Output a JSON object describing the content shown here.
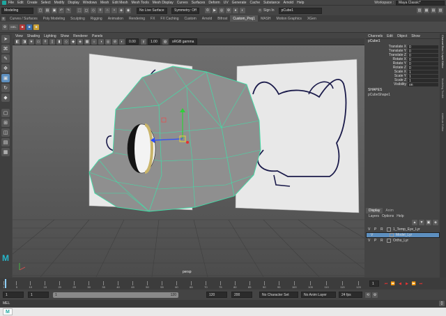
{
  "menubar": {
    "items": [
      "File",
      "Edit",
      "Create",
      "Select",
      "Modify",
      "Display",
      "Windows",
      "Mesh",
      "Edit Mesh",
      "Mesh Tools",
      "Mesh Display",
      "Curves",
      "Surfaces",
      "Deform",
      "UV",
      "Generate",
      "Cache",
      "Substance",
      "Arnold",
      "Help"
    ],
    "workspace_label": "Workspace :",
    "workspace_value": "Maya Classic*"
  },
  "statusline": {
    "mode": "Modeling",
    "live_surface": "No Live Surface",
    "symmetry": "Symmetry: Off",
    "sign_in": "Sign In",
    "search_value": "pCube1"
  },
  "shelf": {
    "tabs": [
      "Curves / Surfaces",
      "Poly Modeling",
      "Sculpting",
      "Rigging",
      "Animation",
      "Rendering",
      "FX",
      "FX Caching",
      "Custom",
      "Arnold",
      "Bifrost",
      "Custom_Proj1",
      "MASH",
      "Motion Graphics",
      "XGen"
    ],
    "active_index": 11
  },
  "viewport": {
    "menu": [
      "View",
      "Shading",
      "Lighting",
      "Show",
      "Renderer",
      "Panels"
    ],
    "gamma": "sRGB gamma",
    "exposure": "0.00",
    "gamma_value": "1.00",
    "camera_label": "persp"
  },
  "channelbox": {
    "tabs": [
      "Channels",
      "Edit",
      "Object",
      "Show"
    ],
    "object_name": "pCube1",
    "attributes": [
      {
        "name": "Translate X",
        "value": "0"
      },
      {
        "name": "Translate Y",
        "value": "0"
      },
      {
        "name": "Translate Z",
        "value": "0"
      },
      {
        "name": "Rotate X",
        "value": "0"
      },
      {
        "name": "Rotate Y",
        "value": "0"
      },
      {
        "name": "Rotate Z",
        "value": "0"
      },
      {
        "name": "Scale X",
        "value": "1"
      },
      {
        "name": "Scale Y",
        "value": "1"
      },
      {
        "name": "Scale Z",
        "value": "1"
      },
      {
        "name": "Visibility",
        "value": "on"
      }
    ],
    "shapes_heading": "SHAPES",
    "shape_name": "pCubeShape1"
  },
  "sidebar_tabs": [
    "Channel Box / Layer Editor",
    "Modeling Toolkit",
    "Attribute Editor"
  ],
  "layers": {
    "tabs": [
      "Display",
      "Anim"
    ],
    "menu": [
      "Layers",
      "Options",
      "Help"
    ],
    "rows": [
      {
        "v": "V",
        "p": "P",
        "r": "R",
        "name": "1_Temp_Eye_Lyr",
        "selected": false
      },
      {
        "v": "V",
        "p": "",
        "r": "",
        "name": "Model_Lyr",
        "selected": true
      },
      {
        "v": "V",
        "p": "P",
        "r": "R",
        "name": "Ortho_Lyr",
        "selected": false
      }
    ]
  },
  "timeslider": {
    "ticks": [
      "1",
      "5",
      "10",
      "15",
      "20",
      "25",
      "30",
      "35",
      "40",
      "45",
      "50",
      "55",
      "60",
      "65",
      "70",
      "75",
      "80",
      "85",
      "90",
      "95",
      "100",
      "105",
      "110",
      "115",
      "120"
    ],
    "current_frame": "1"
  },
  "rangeslider": {
    "start": "1",
    "start2": "1",
    "range_start": "1",
    "range_end": "120",
    "end": "120",
    "end2": "200",
    "character_set": "No Character Set",
    "anim_layer": "No Anim Layer",
    "fps": "24 fps"
  },
  "cmdline": {
    "label": "MEL"
  },
  "taskbar": {
    "app_label": "M"
  }
}
